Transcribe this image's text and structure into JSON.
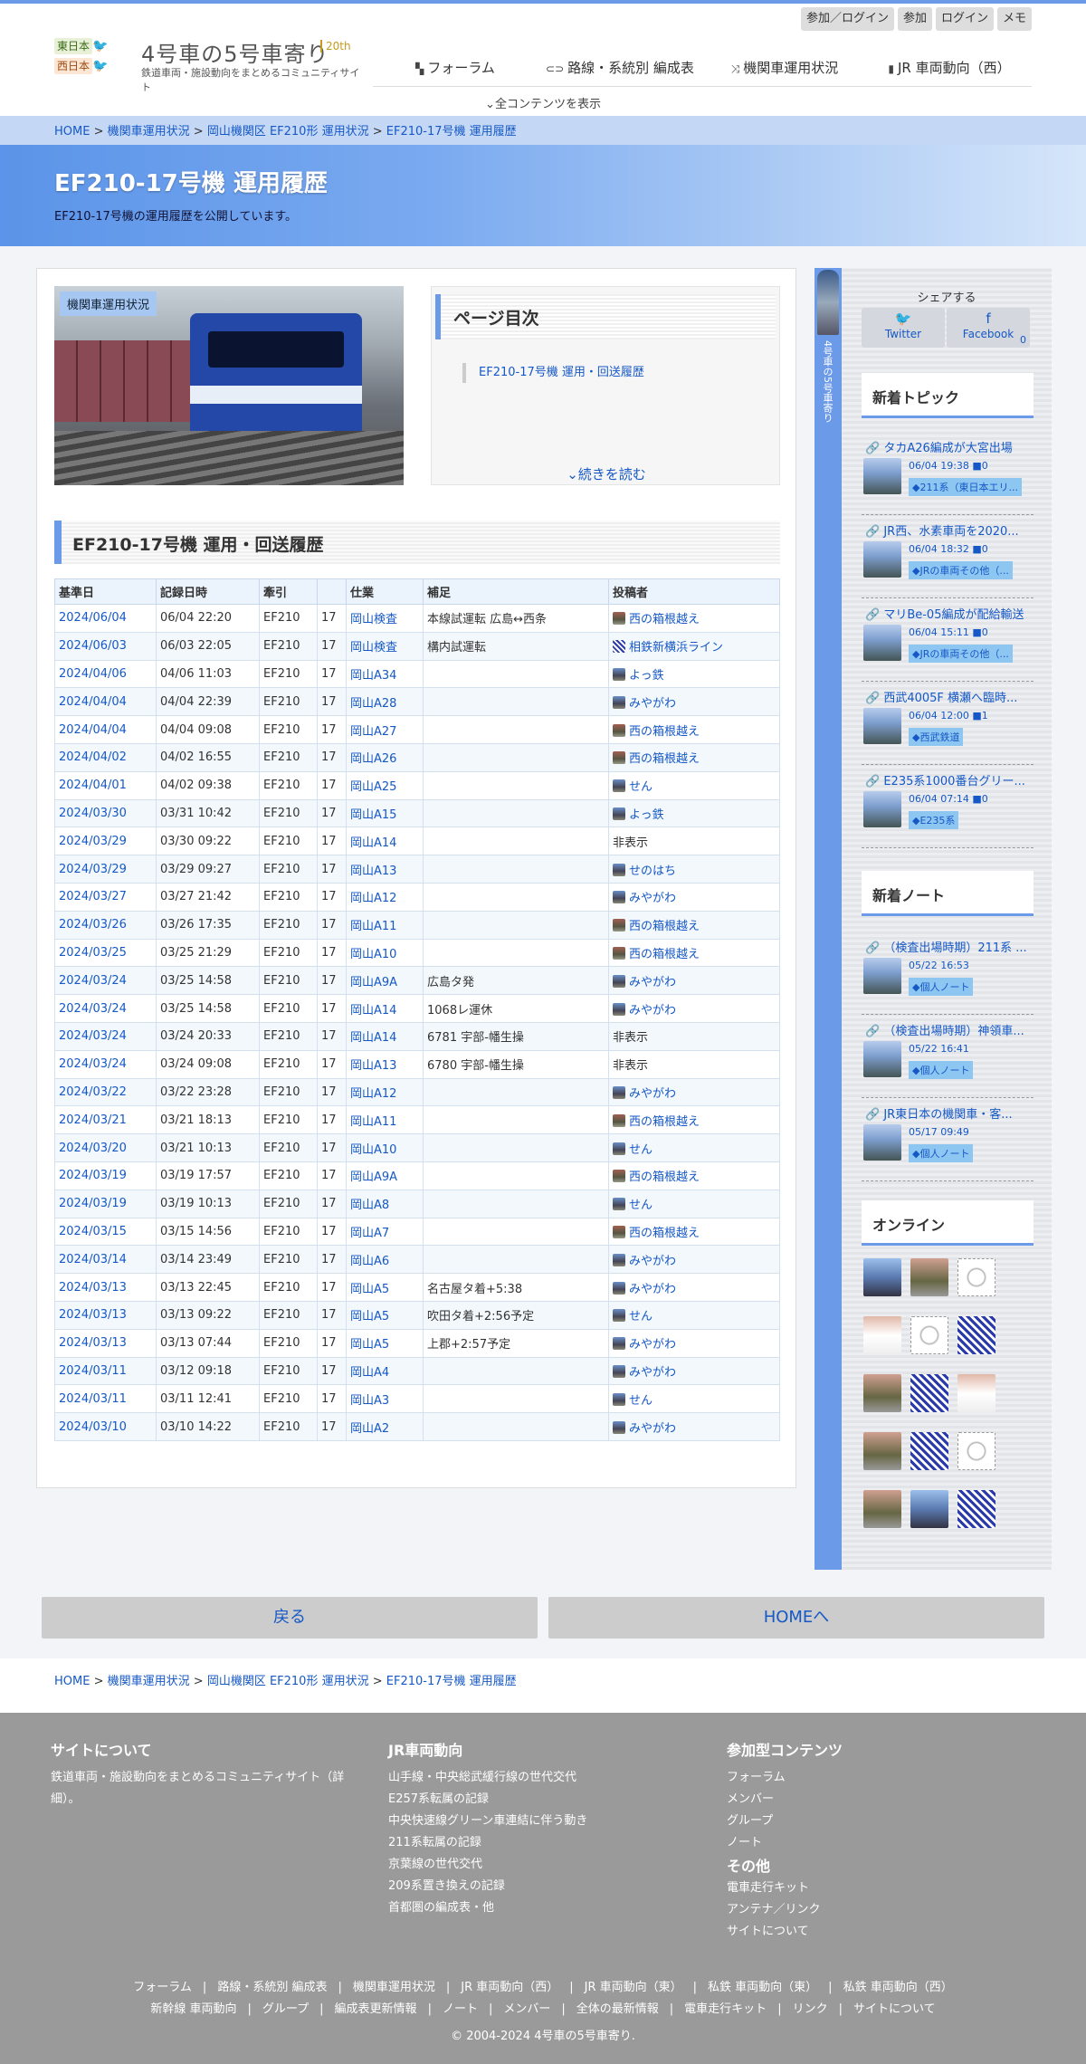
{
  "header": {
    "tag_east": "東日本",
    "tag_west": "西日本",
    "site_title": "4号車の5号車寄り",
    "anniversary": "20th",
    "tagline": "鉄道車両・施設動向をまとめるコミュニティサイト",
    "top_links": [
      "参加／ログイン",
      "参加",
      "ログイン",
      "メモ"
    ],
    "nav": [
      "フォーラム",
      "路線・系統別 編成表",
      "機関車運用状況",
      "JR 車両動向（西）"
    ],
    "show_all": "全コンテンツを表示"
  },
  "breadcrumb": [
    "HOME",
    "機関車運用状況",
    "岡山機関区 EF210形 運用状況",
    "EF210-17号機 運用履歴"
  ],
  "hero": {
    "title": "EF210-17号機 運用履歴",
    "description": "EF210-17号機の運用履歴を公開しています。"
  },
  "photo_badge": "機関車運用状況",
  "toc": {
    "title": "ページ目次",
    "items": [
      "EF210-17号機 運用・回送履歴"
    ],
    "more": "続きを読む"
  },
  "section_title": "EF210-17号機 運用・回送履歴",
  "table": {
    "headers": [
      "基準日",
      "記録日時",
      "牽引",
      "",
      "仕業",
      "補足",
      "投稿者"
    ],
    "rows": [
      [
        "2024/06/04",
        "06/04 22:20",
        "EF210",
        "17",
        "岡山検査",
        "本線試運転 広島↔西条",
        "西の箱根越え"
      ],
      [
        "2024/06/03",
        "06/03 22:05",
        "EF210",
        "17",
        "岡山検査",
        "構内試運転",
        "相鉄新横浜ライン"
      ],
      [
        "2024/04/06",
        "04/06 11:03",
        "EF210",
        "17",
        "岡山A34",
        "",
        "よっ鉄"
      ],
      [
        "2024/04/04",
        "04/04 22:39",
        "EF210",
        "17",
        "岡山A28",
        "",
        "みやがわ"
      ],
      [
        "2024/04/04",
        "04/04 09:08",
        "EF210",
        "17",
        "岡山A27",
        "",
        "西の箱根越え"
      ],
      [
        "2024/04/02",
        "04/02 16:55",
        "EF210",
        "17",
        "岡山A26",
        "",
        "西の箱根越え"
      ],
      [
        "2024/04/01",
        "04/02 09:38",
        "EF210",
        "17",
        "岡山A25",
        "",
        "せん"
      ],
      [
        "2024/03/30",
        "03/31 10:42",
        "EF210",
        "17",
        "岡山A15",
        "",
        "よっ鉄"
      ],
      [
        "2024/03/29",
        "03/30 09:22",
        "EF210",
        "17",
        "岡山A14",
        "",
        "非表示"
      ],
      [
        "2024/03/29",
        "03/29 09:27",
        "EF210",
        "17",
        "岡山A13",
        "",
        "せのはち"
      ],
      [
        "2024/03/27",
        "03/27 21:42",
        "EF210",
        "17",
        "岡山A12",
        "",
        "みやがわ"
      ],
      [
        "2024/03/26",
        "03/26 17:35",
        "EF210",
        "17",
        "岡山A11",
        "",
        "西の箱根越え"
      ],
      [
        "2024/03/25",
        "03/25 21:29",
        "EF210",
        "17",
        "岡山A10",
        "",
        "西の箱根越え"
      ],
      [
        "2024/03/24",
        "03/25 14:58",
        "EF210",
        "17",
        "岡山A9A",
        "広島タ発",
        "みやがわ"
      ],
      [
        "2024/03/24",
        "03/25 14:58",
        "EF210",
        "17",
        "岡山A14",
        "1068レ運休",
        "みやがわ"
      ],
      [
        "2024/03/24",
        "03/24 20:33",
        "EF210",
        "17",
        "岡山A14",
        "6781 宇部-幡生操",
        "非表示"
      ],
      [
        "2024/03/24",
        "03/24 09:08",
        "EF210",
        "17",
        "岡山A13",
        "6780 宇部-幡生操",
        "非表示"
      ],
      [
        "2024/03/22",
        "03/22 23:28",
        "EF210",
        "17",
        "岡山A12",
        "",
        "みやがわ"
      ],
      [
        "2024/03/21",
        "03/21 18:13",
        "EF210",
        "17",
        "岡山A11",
        "",
        "西の箱根越え"
      ],
      [
        "2024/03/20",
        "03/21 10:13",
        "EF210",
        "17",
        "岡山A10",
        "",
        "せん"
      ],
      [
        "2024/03/19",
        "03/19 17:57",
        "EF210",
        "17",
        "岡山A9A",
        "",
        "西の箱根越え"
      ],
      [
        "2024/03/19",
        "03/19 10:13",
        "EF210",
        "17",
        "岡山A8",
        "",
        "せん"
      ],
      [
        "2024/03/15",
        "03/15 14:56",
        "EF210",
        "17",
        "岡山A7",
        "",
        "西の箱根越え"
      ],
      [
        "2024/03/14",
        "03/14 23:49",
        "EF210",
        "17",
        "岡山A6",
        "",
        "みやがわ"
      ],
      [
        "2024/03/13",
        "03/13 22:45",
        "EF210",
        "17",
        "岡山A5",
        "名古屋タ着+5:38",
        "みやがわ"
      ],
      [
        "2024/03/13",
        "03/13 09:22",
        "EF210",
        "17",
        "岡山A5",
        "吹田タ着+2:56予定",
        "せん"
      ],
      [
        "2024/03/13",
        "03/13 07:44",
        "EF210",
        "17",
        "岡山A5",
        "上郡+2:57予定",
        "みやがわ"
      ],
      [
        "2024/03/11",
        "03/12 09:18",
        "EF210",
        "17",
        "岡山A4",
        "",
        "みやがわ"
      ],
      [
        "2024/03/11",
        "03/11 12:41",
        "EF210",
        "17",
        "岡山A3",
        "",
        "せん"
      ],
      [
        "2024/03/10",
        "03/10 14:22",
        "EF210",
        "17",
        "岡山A2",
        "",
        "みやがわ"
      ]
    ]
  },
  "sidebar": {
    "vertical_text": "4号車の5号車寄り",
    "share_title": "シェアする",
    "twitter": "Twitter",
    "facebook": "Facebook",
    "facebook_count": "0",
    "new_topics_title": "新着トピック",
    "topics": [
      {
        "title": "タカA26編成が大宮出場",
        "date": "06/04 19:38 ■0",
        "cat": "211系（東日本エリ..."
      },
      {
        "title": "JR西、水素車両を2020...",
        "date": "06/04 18:32 ■0",
        "cat": "JRの車両その他（..."
      },
      {
        "title": "マリBe-05編成が配給輸送",
        "date": "06/04 15:11 ■0",
        "cat": "JRの車両その他（..."
      },
      {
        "title": "西武4005F 横瀬へ臨時...",
        "date": "06/04 12:00 ■1",
        "cat": "西武鉄道"
      },
      {
        "title": "E235系1000番台グリー...",
        "date": "06/04 07:14 ■0",
        "cat": "E235系"
      }
    ],
    "new_notes_title": "新着ノート",
    "notes": [
      {
        "title": "（検査出場時期）211系 ...",
        "date": "05/22 16:53",
        "cat": "個人ノート"
      },
      {
        "title": "（検査出場時期）神領車...",
        "date": "05/22 16:41",
        "cat": "個人ノート"
      },
      {
        "title": "JR東日本の機関車・客...",
        "date": "05/17 09:49",
        "cat": "個人ノート"
      }
    ],
    "online_title": "オンライン"
  },
  "buttons": {
    "back": "戻る",
    "home": "HOMEへ"
  },
  "footer": {
    "about_title": "サイトについて",
    "about_text": "鉄道車両・施設動向をまとめるコミュニティサイト（詳細）。",
    "jr_title": "JR車両動向",
    "jr_links": [
      "山手線・中央総武緩行線の世代交代",
      "E257系転属の記録",
      "中央快速線グリーン車連結に伴う動き",
      "211系転属の記録",
      "京葉線の世代交代",
      "209系置き換えの記録",
      "首都圏の編成表・他"
    ],
    "join_title": "参加型コンテンツ",
    "join_links": [
      "フォーラム",
      "メンバー",
      "グループ",
      "ノート"
    ],
    "other_title": "その他",
    "other_links": [
      "電車走行キット",
      "アンテナ／リンク",
      "サイトについて"
    ],
    "nav_row1": [
      "フォーラム",
      "路線・系統別 編成表",
      "機関車運用状況",
      "JR 車両動向（西）",
      "JR 車両動向（東）",
      "私鉄 車両動向（東）",
      "私鉄 車両動向（西）"
    ],
    "nav_row2": [
      "新幹線 車両動向",
      "グループ",
      "編成表更新情報",
      "ノート",
      "メンバー",
      "全体の最新情報",
      "電車走行キット",
      "リンク",
      "サイトについて"
    ],
    "copyright": "© 2004-2024 4号車の5号車寄り."
  }
}
